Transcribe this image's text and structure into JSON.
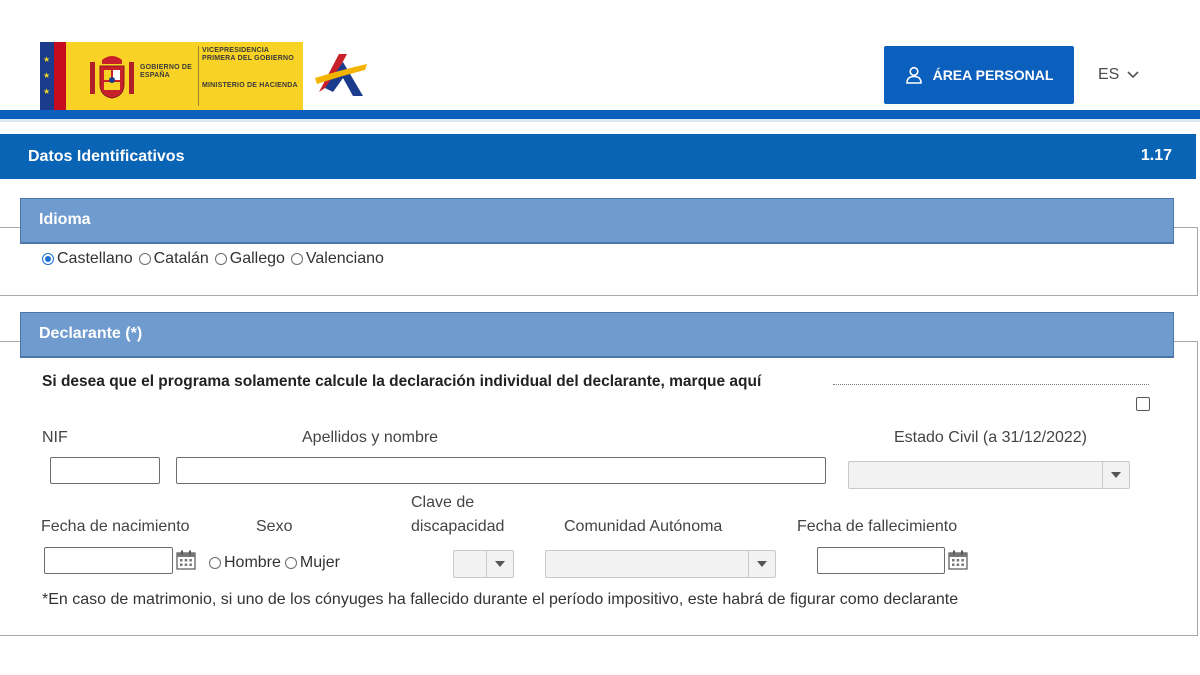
{
  "header": {
    "gov_text_small": "GOBIERNO DE ESPAÑA",
    "gov_text_vice": "VICEPRESIDENCIA PRIMERA DEL GOBIERNO",
    "gov_text_min": "MINISTERIO DE HACIENDA",
    "area_personal_label": "ÁREA PERSONAL",
    "language": "ES",
    "brand_blue": "#0b5fbd",
    "logo_yellow": "#f8d224"
  },
  "section": {
    "title": "Datos Identificativos",
    "version": "1.17"
  },
  "idioma": {
    "heading": "Idioma",
    "options": [
      {
        "label": "Castellano",
        "checked": true
      },
      {
        "label": "Catalán",
        "checked": false
      },
      {
        "label": "Gallego",
        "checked": false
      },
      {
        "label": "Valenciano",
        "checked": false
      }
    ]
  },
  "declarante": {
    "heading": "Declarante (*)",
    "individual_prompt": "Si desea que el programa solamente calcule la declaración individual del declarante, marque aquí",
    "labels": {
      "nif": "NIF",
      "apellidos": "Apellidos y nombre",
      "estado_civil": "Estado Civil (a 31/12/2022)",
      "fecha_nacimiento": "Fecha de nacimiento",
      "sexo": "Sexo",
      "clave_1": "Clave de",
      "clave_2": "discapacidad",
      "comunidad": "Comunidad Autónoma",
      "fecha_fallecimiento": "Fecha de fallecimiento"
    },
    "sexo_options": [
      "Hombre",
      "Mujer"
    ],
    "footnote": "*En caso de matrimonio, si uno de los cónyuges ha fallecido durante el período impositivo, este habrá de figurar como declarante"
  }
}
